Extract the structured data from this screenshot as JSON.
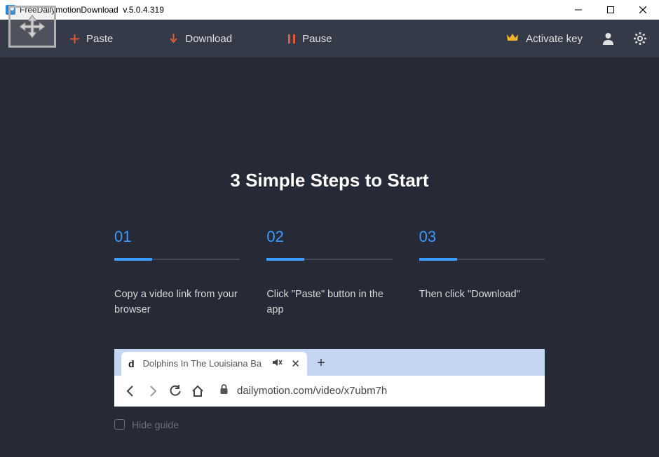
{
  "titlebar": {
    "app_name": "FreeDailymotionDownload",
    "version": "v.5.0.4.319"
  },
  "toolbar": {
    "paste_label": "Paste",
    "download_label": "Download",
    "pause_label": "Pause",
    "activate_label": "Activate key"
  },
  "content": {
    "heading": "3 Simple Steps to Start",
    "steps": [
      {
        "num": "01",
        "text": "Copy a video link from your browser"
      },
      {
        "num": "02",
        "text": "Click \"Paste\" button in the app"
      },
      {
        "num": "03",
        "text": "Then click \"Download\""
      }
    ],
    "browser_mock": {
      "tab_title": "Dolphins In The Louisiana Ba",
      "url": "dailymotion.com/video/x7ubm7h"
    },
    "hide_guide_label": "Hide guide"
  }
}
